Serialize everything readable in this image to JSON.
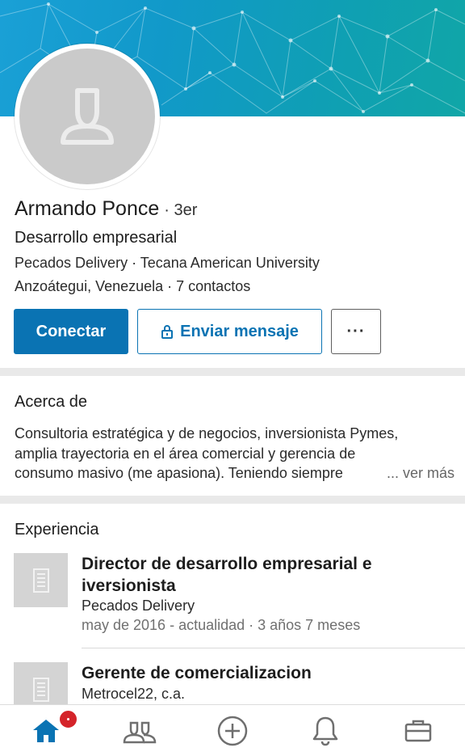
{
  "profile": {
    "name": "Armando Ponce",
    "degree": "· 3er",
    "headline": "Desarrollo empresarial",
    "companies": "Pecados Delivery · Tecana American University",
    "location": "Anzoátegui, Venezuela · 7 contactos"
  },
  "actions": {
    "connect": "Conectar",
    "message": "Enviar mensaje",
    "more": "···"
  },
  "about": {
    "title": "Acerca de",
    "line1": "Consultoria estratégica y de negocios, inversionista Pymes,",
    "line2": "amplia trayectoria en el área comercial y gerencia de",
    "line3": "consumo masivo (me apasiona). Teniendo siempre",
    "see_more": "... ver más"
  },
  "experience": {
    "title": "Experiencia",
    "items": [
      {
        "title": "Director de desarrollo empresarial e iversionista",
        "company": "Pecados Delivery",
        "dates": "may de 2016 - actualidad  · 3 años 7 meses"
      },
      {
        "title": "Gerente de comercializacion",
        "company": "Metrocel22, c.a."
      }
    ]
  },
  "nav": {
    "items": [
      "home-icon",
      "my-network-icon",
      "post-icon",
      "notifications-icon",
      "jobs-icon"
    ],
    "active": "home-icon",
    "home_badge": true
  },
  "colors": {
    "primary": "#0a73b3",
    "badge": "#d4242a",
    "banner_start": "#1aa0d6",
    "banner_end": "#10a6a7"
  }
}
